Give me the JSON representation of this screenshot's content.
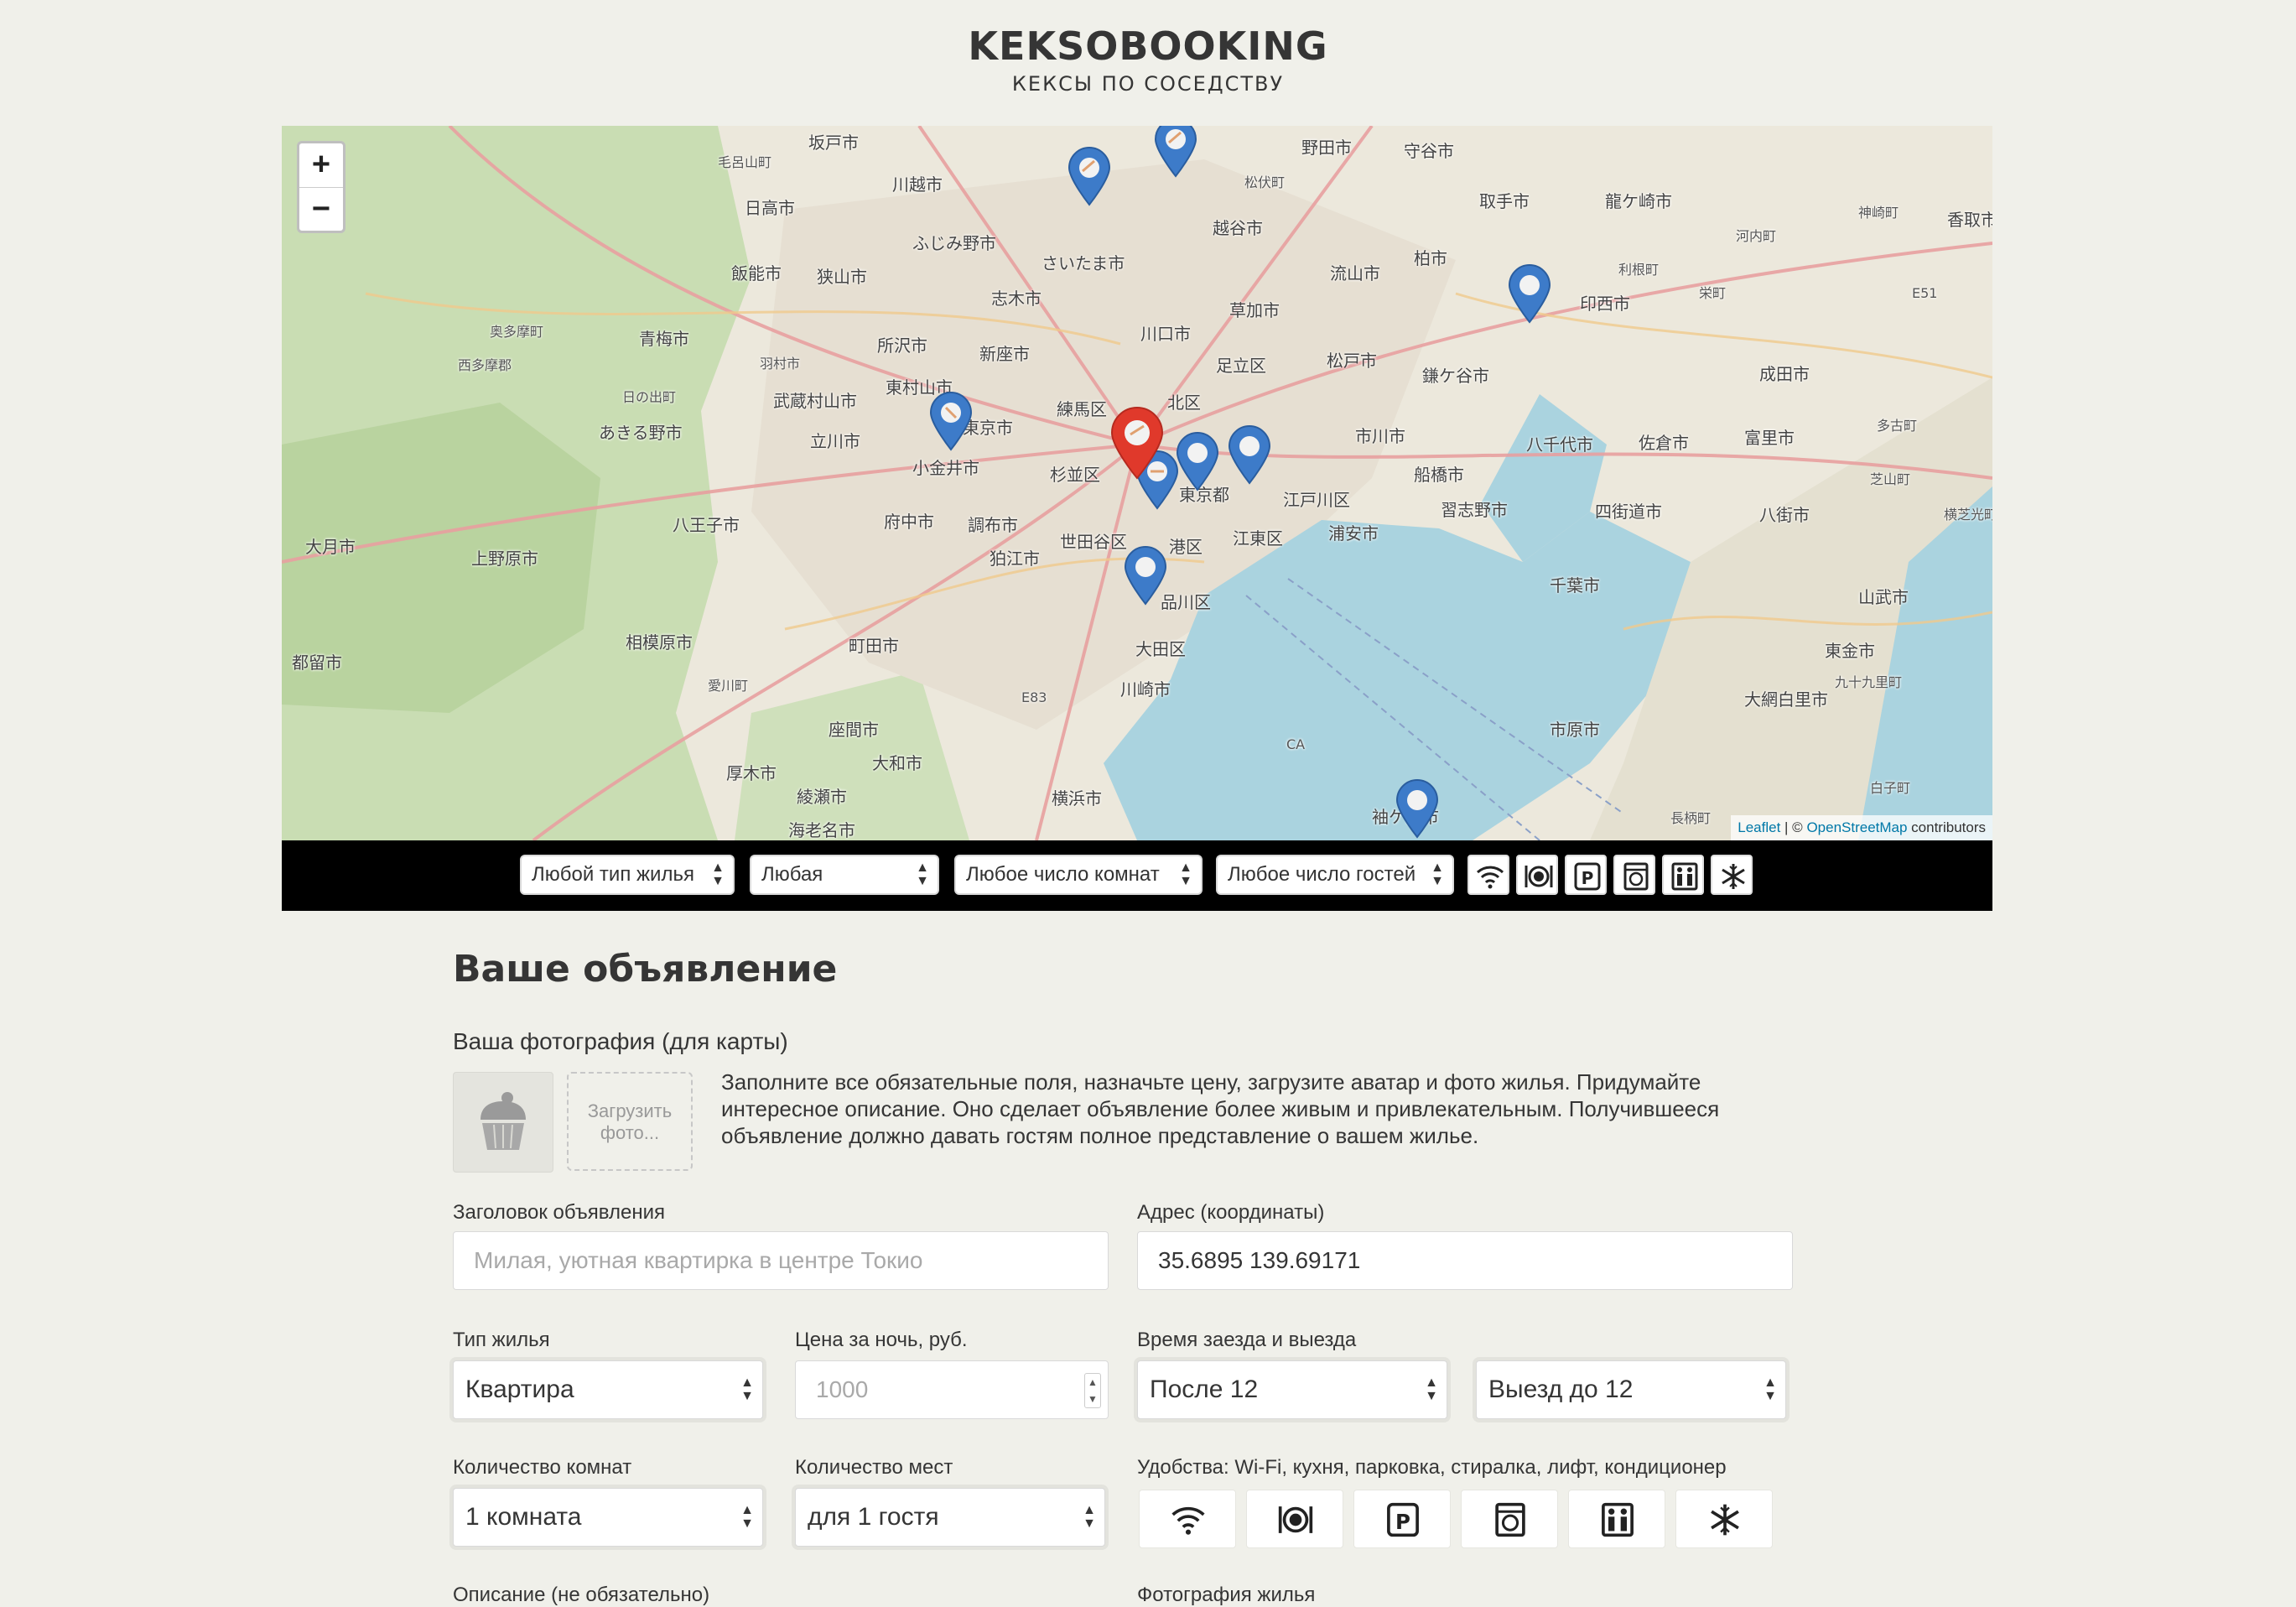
{
  "header": {
    "logo": "KEKSOBOOKING",
    "subtitle": "КЕКСЫ ПО СОСЕДСТВУ"
  },
  "map": {
    "zoom_in": "+",
    "zoom_out": "−",
    "attribution": {
      "leaflet": "Leaflet",
      "separator": " | © ",
      "osm": "OpenStreetMap",
      "contributors": " contributors"
    },
    "places": [
      {
        "name": "坂戸市"
      },
      {
        "name": "毛呂山町"
      },
      {
        "name": "日高市"
      },
      {
        "name": "川越市"
      },
      {
        "name": "ふじみ野市"
      },
      {
        "name": "野田市"
      },
      {
        "name": "守谷市"
      },
      {
        "name": "松伏町"
      },
      {
        "name": "越谷市"
      },
      {
        "name": "取手市"
      },
      {
        "name": "龍ケ崎市"
      },
      {
        "name": "河内町"
      },
      {
        "name": "神崎町"
      },
      {
        "name": "香取市"
      },
      {
        "name": "さいたま市"
      },
      {
        "name": "飯能市"
      },
      {
        "name": "狭山市"
      },
      {
        "name": "志木市"
      },
      {
        "name": "流山市"
      },
      {
        "name": "柏市"
      },
      {
        "name": "利根町"
      },
      {
        "name": "印西市"
      },
      {
        "name": "栄町"
      },
      {
        "name": "奥多摩町"
      },
      {
        "name": "青梅市"
      },
      {
        "name": "西多摩郡"
      },
      {
        "name": "所沢市"
      },
      {
        "name": "新座市"
      },
      {
        "name": "川口市"
      },
      {
        "name": "草加市"
      },
      {
        "name": "羽村市"
      },
      {
        "name": "足立区"
      },
      {
        "name": "松戸市"
      },
      {
        "name": "鎌ケ谷市"
      },
      {
        "name": "成田市"
      },
      {
        "name": "東村山市"
      },
      {
        "name": "日の出町"
      },
      {
        "name": "武蔵村山市"
      },
      {
        "name": "練馬区"
      },
      {
        "name": "北区"
      },
      {
        "name": "あきる野市"
      },
      {
        "name": "立川市"
      },
      {
        "name": "東京市"
      },
      {
        "name": "小金井市"
      },
      {
        "name": "市川市"
      },
      {
        "name": "八千代市"
      },
      {
        "name": "佐倉市"
      },
      {
        "name": "富里市"
      },
      {
        "name": "多古町"
      },
      {
        "name": "杉並区"
      },
      {
        "name": "東京都"
      },
      {
        "name": "江戸川区"
      },
      {
        "name": "船橋市"
      },
      {
        "name": "芝山町"
      },
      {
        "name": "大月市"
      },
      {
        "name": "八王子市"
      },
      {
        "name": "府中市"
      },
      {
        "name": "調布市"
      },
      {
        "name": "習志野市"
      },
      {
        "name": "四街道市"
      },
      {
        "name": "八街市"
      },
      {
        "name": "横芝光町"
      },
      {
        "name": "上野原市"
      },
      {
        "name": "狛江市"
      },
      {
        "name": "世田谷区"
      },
      {
        "name": "港区"
      },
      {
        "name": "江東区"
      },
      {
        "name": "浦安市"
      },
      {
        "name": "品川区"
      },
      {
        "name": "千葉市"
      },
      {
        "name": "山武市"
      },
      {
        "name": "相模原市"
      },
      {
        "name": "町田市"
      },
      {
        "name": "大田区"
      },
      {
        "name": "東金市"
      },
      {
        "name": "九十九里町"
      },
      {
        "name": "都留市"
      },
      {
        "name": "愛川町"
      },
      {
        "name": "川崎市"
      },
      {
        "name": "大網白里市"
      },
      {
        "name": "E83"
      },
      {
        "name": "座間市"
      },
      {
        "name": "市原市"
      },
      {
        "name": "CA"
      },
      {
        "name": "厚木市"
      },
      {
        "name": "大和市"
      },
      {
        "name": "綾瀬市"
      },
      {
        "name": "横浜市"
      },
      {
        "name": "白子町"
      },
      {
        "name": "海老名市"
      },
      {
        "name": "袖ケ浦市"
      },
      {
        "name": "長柄町"
      },
      {
        "name": "E51"
      }
    ]
  },
  "filters": {
    "housing_type": "Любой тип жилья",
    "price": "Любая",
    "rooms": "Любое число комнат",
    "guests": "Любое число гостей",
    "features": [
      {
        "icon": "wifi-icon"
      },
      {
        "icon": "kitchen-icon"
      },
      {
        "icon": "parking-icon"
      },
      {
        "icon": "washer-icon"
      },
      {
        "icon": "elevator-icon"
      },
      {
        "icon": "conditioner-icon"
      }
    ]
  },
  "form": {
    "title": "Ваше объявление",
    "avatar_label": "Ваша фотография (для карты)",
    "upload": {
      "line1": "Загрузить",
      "line2": "фото..."
    },
    "note": {
      "line1": "Заполните все обязательные поля, назначьте цену, загрузите аватар и фото жилья. Придумайте",
      "line2": "интересное описание. Оно сделает объявление более живым и привлекательным. Получившееся",
      "line3": "объявление должно давать гостям полное представление о вашем жилье."
    },
    "title_label": "Заголовок объявления",
    "title_placeholder": "Милая, уютная квартирка в центре Токио",
    "address_label": "Адрес (координаты)",
    "address_value": "35.6895 139.69171",
    "type_label": "Тип жилья",
    "type_value": "Квартира",
    "price_label": "Цена за ночь, руб.",
    "price_placeholder": "1000",
    "time_label": "Время заезда и выезда",
    "checkin_value": "После 12",
    "checkout_value": "Выезд до 12",
    "rooms_label": "Количество комнат",
    "rooms_value": "1 комната",
    "capacity_label": "Количество мест",
    "capacity_value": "для 1 гостя",
    "features_label": "Удобства: Wi-Fi, кухня, парковка, стиралка, лифт, кондиционер",
    "description_label": "Описание (не обязательно)",
    "photo_label": "Фотография жилья"
  },
  "colors": {
    "background": "#f0f0ea",
    "pin_blue": "#3d7bc9",
    "pin_red": "#e0392b",
    "water": "#aad3df",
    "filter_bar": "#000000"
  }
}
